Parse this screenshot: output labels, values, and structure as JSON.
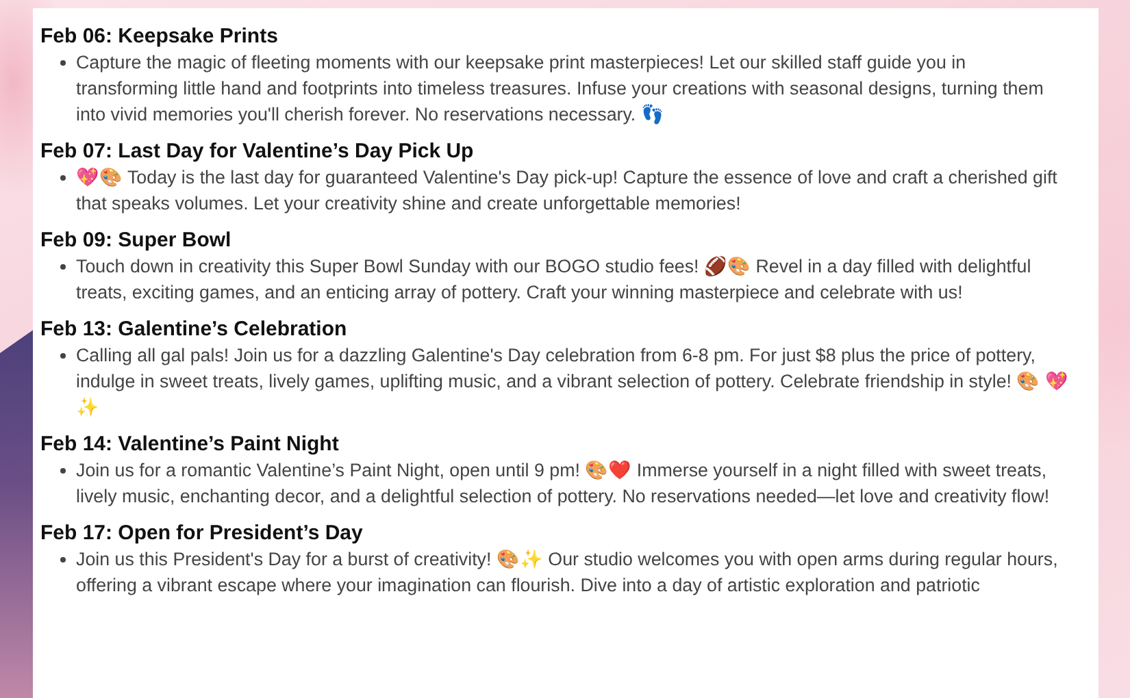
{
  "events": [
    {
      "title": "Feb 06: Keepsake Prints",
      "text": "Capture the magic of fleeting moments with our keepsake print masterpieces! Let our skilled staff guide you in transforming little hand and footprints into timeless treasures. Infuse your creations with seasonal designs, turning them into vivid memories you'll cherish forever. No reservations necessary. 👣"
    },
    {
      "title": "Feb 07: Last Day for Valentine’s Day Pick Up",
      "text": "💖🎨 Today is the last day for guaranteed Valentine's Day pick-up! Capture the essence of love and craft a cherished gift that speaks volumes. Let your creativity shine and create unforgettable memories!"
    },
    {
      "title": "Feb 09: Super Bowl",
      "text": "Touch down in creativity this Super Bowl Sunday with our BOGO studio fees! 🏈🎨 Revel in a day filled with delightful treats, exciting games, and an enticing array of pottery. Craft your winning masterpiece and celebrate with us!"
    },
    {
      "title": "Feb 13: Galentine’s Celebration",
      "text": "Calling all gal pals! Join us for a dazzling Galentine's Day celebration from 6-8 pm. For just $8 plus the price of pottery, indulge in sweet treats, lively games, uplifting music, and a vibrant selection of pottery. Celebrate friendship in style! 🎨 💖✨"
    },
    {
      "title": "Feb 14: Valentine’s Paint Night",
      "text": "Join us for a romantic Valentine’s Paint Night, open until 9 pm! 🎨❤️ Immerse yourself in a night filled with sweet treats, lively music, enchanting decor, and a delightful selection of pottery. No reservations needed—let love and creativity flow!"
    },
    {
      "title": "Feb 17: Open for President’s Day",
      "text": "Join us this President's Day for a burst of creativity! 🎨✨ Our studio welcomes you with open arms during regular hours, offering a vibrant escape where your imagination can flourish. Dive into a day of artistic exploration and patriotic"
    }
  ]
}
